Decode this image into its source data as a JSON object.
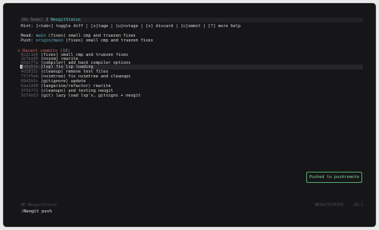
{
  "tabline": {
    "buffer_label": "[No Name]",
    "tab_number": "3",
    "tab_title": "NeogitStatus"
  },
  "hint": "Hint: [<tab>] toggle diff | [s]tage | [u]nstage | [x] discard | [c]ommit | [?] more help",
  "head": {
    "label": "Head:",
    "branch": "main",
    "message": "(fixes) small cmp and truezen fixes"
  },
  "push": {
    "label": "Push:",
    "remote": "origin/main",
    "message": "(fixes) small cmp and truezen fixes"
  },
  "recent": {
    "chevron": "v",
    "title": "Recent commits",
    "count": "(10)",
    "commits": [
      {
        "hash": "0c2c1e6",
        "message": "(fixes) small cmp and truezen fixes"
      },
      {
        "hash": "2b7ea05",
        "message": "(nvyom) rewrite"
      },
      {
        "hash": "b6d2f7a",
        "message": "(compiler) add back compiler options"
      },
      {
        "hash": "3b0a5fe",
        "message": "(lsp) fix lsp loading"
      },
      {
        "hash": "4d1813c",
        "message": "(cleanup) remove test files"
      },
      {
        "hash": "7f1f5eb",
        "message": "(nvimtree) fix nvimtree and cleanups"
      },
      {
        "hash": "09d5b5c",
        "message": "(gitignore) update"
      },
      {
        "hash": "6aa1d90",
        "message": "(tangerine/refactor) rewrite"
      },
      {
        "hash": "3f5b7f2",
        "message": "(cleanups) and testing neogit"
      },
      {
        "hash": "1079e53",
        "message": "(git) lazy load lsp's, gitsigns + neogit"
      }
    ]
  },
  "toast": "Pushed to pushremote",
  "statusline": {
    "left": "NE NeogitStatus",
    "mode": "NEOGITSTATUS",
    "position": "10:1"
  },
  "cmdline": ":Neogit push",
  "colors": {
    "background": "#161618",
    "accent": "#55c2c0",
    "success": "#7ed39a"
  }
}
